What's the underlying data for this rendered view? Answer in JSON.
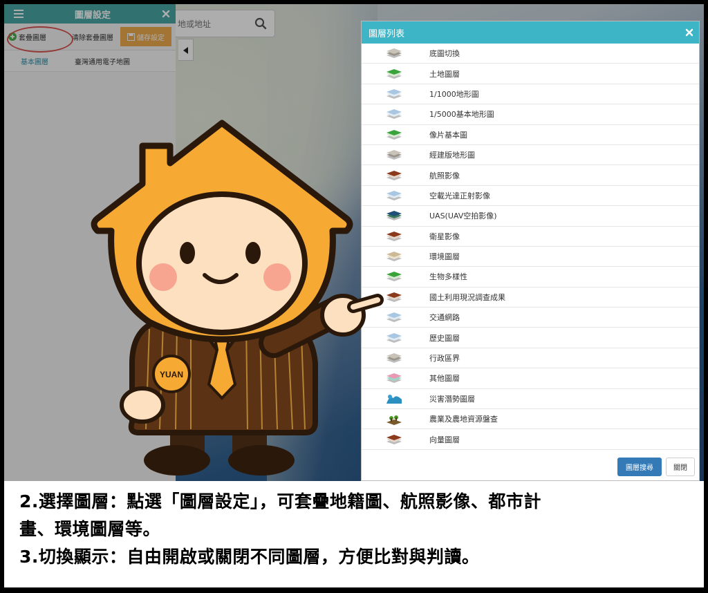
{
  "search": {
    "placeholder": "地或地址"
  },
  "left_panel": {
    "title": "圖層設定",
    "add_layer": "套疊圖層",
    "clear_layer": "清除套疊圖層",
    "save_settings": "儲存設定",
    "rows": [
      {
        "category": "基本圖層",
        "name": "臺灣通用電子地圖"
      }
    ]
  },
  "dialog": {
    "title": "圖層列表",
    "items": [
      {
        "label": "底圖切換",
        "icon": "layer-stack-gray-icon"
      },
      {
        "label": "土地圖層",
        "icon": "layer-stack-green-icon"
      },
      {
        "label": "1/1000地形圖",
        "icon": "layer-stack-blue-icon"
      },
      {
        "label": "1/5000基本地形圖",
        "icon": "layer-stack-blue-icon"
      },
      {
        "label": "像片基本圖",
        "icon": "layer-stack-green-icon"
      },
      {
        "label": "經建版地形圖",
        "icon": "layer-stack-gray-icon"
      },
      {
        "label": "航照影像",
        "icon": "layer-stack-brown-icon"
      },
      {
        "label": "空載光達正射影像",
        "icon": "layer-stack-blue-icon"
      },
      {
        "label": "UAS(UAV空拍影像)",
        "icon": "layer-stack-navy-icon"
      },
      {
        "label": "衛星影像",
        "icon": "layer-stack-brown-icon"
      },
      {
        "label": "環境圖層",
        "icon": "layer-stack-tan-icon"
      },
      {
        "label": "生物多樣性",
        "icon": "layer-stack-green-icon"
      },
      {
        "label": "國土利用現況調查成果",
        "icon": "layer-stack-brown-icon"
      },
      {
        "label": "交通網路",
        "icon": "layer-stack-blue-icon"
      },
      {
        "label": "歷史圖層",
        "icon": "layer-stack-blue-icon"
      },
      {
        "label": "行政區界",
        "icon": "layer-stack-gray-icon"
      },
      {
        "label": "其他圖層",
        "icon": "layer-stack-pink-icon"
      },
      {
        "label": "災害潛勢圖層",
        "icon": "disaster-icon"
      },
      {
        "label": "農業及農地資源盤查",
        "icon": "farm-icon"
      },
      {
        "label": "向量圖層",
        "icon": "layer-stack-brown-icon"
      }
    ],
    "search_button": "圖層搜尋",
    "close_button": "關閉"
  },
  "mascot": {
    "badge": "YUAN"
  },
  "caption": {
    "line1": "2.選擇圖層：點選「圖層設定」，可套疊地籍圖、航照影像、都市計",
    "line2": "畫、環境圖層等。",
    "line3": "3.切換顯示：自由開啟或關閉不同圖層，方便比對與判讀。"
  },
  "colors": {
    "panel_header": "#49a8a7",
    "dialog_header": "#3db5c6",
    "save_button": "#f0ad4e",
    "primary_button": "#337ab7",
    "mascot_orange": "#f6a933",
    "highlight_circle": "#d9534f"
  }
}
